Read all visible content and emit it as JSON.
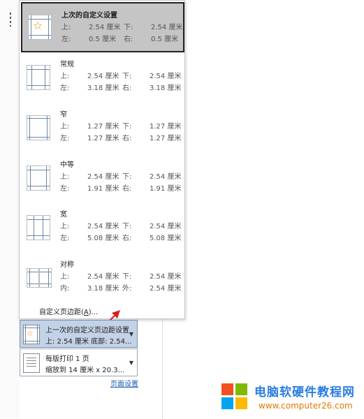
{
  "margins": {
    "options": [
      {
        "title": "上次的自定义设置",
        "k1": "上:",
        "v1": "2.54 厘米",
        "k2": "下:",
        "v2": "2.54 厘米",
        "k3": "左:",
        "v3": "0.5 厘米",
        "k4": "右:",
        "v4": "0.5 厘米"
      },
      {
        "title": "常规",
        "k1": "上:",
        "v1": "2.54 厘米",
        "k2": "下:",
        "v2": "2.54 厘米",
        "k3": "左:",
        "v3": "3.18 厘米",
        "k4": "右:",
        "v4": "3.18 厘米"
      },
      {
        "title": "窄",
        "k1": "上:",
        "v1": "1.27 厘米",
        "k2": "下:",
        "v2": "1.27 厘米",
        "k3": "左:",
        "v3": "1.27 厘米",
        "k4": "右:",
        "v4": "1.27 厘米"
      },
      {
        "title": "中等",
        "k1": "上:",
        "v1": "2.54 厘米",
        "k2": "下:",
        "v2": "2.54 厘米",
        "k3": "左:",
        "v3": "1.91 厘米",
        "k4": "右:",
        "v4": "1.91 厘米"
      },
      {
        "title": "宽",
        "k1": "上:",
        "v1": "2.54 厘米",
        "k2": "下:",
        "v2": "2.54 厘米",
        "k3": "左:",
        "v3": "5.08 厘米",
        "k4": "右:",
        "v4": "5.08 厘米"
      },
      {
        "title": "对称",
        "k1": "上:",
        "v1": "2.54 厘米",
        "k2": "下:",
        "v2": "2.54 厘米",
        "k3": "内:",
        "v3": "3.18 厘米",
        "k4": "外:",
        "v4": "2.54 厘米"
      }
    ],
    "custom_label": "自定义页边距(",
    "custom_key": "A",
    "custom_suffix": ")...",
    "selected_index": 0
  },
  "margin_button": {
    "line1": "上一次的自定义页边距设置",
    "line2": "上: 2.54 厘米 底部: 2.54..."
  },
  "pages_button": {
    "line1": "每版打印 1 页",
    "line2": "缩放到 14 厘米 x 20.3..."
  },
  "page_setup_link": "页面设置",
  "watermark": {
    "title": "电脑软硬件教程网",
    "url": "www.computer26.com",
    "colors": {
      "red": "#f25022",
      "green": "#7fba00",
      "blue": "#00a4ef",
      "yellow": "#ffb900"
    }
  },
  "icons": [
    "star-icon",
    "margin-page-icon",
    "chevron-down-icon",
    "windows-logo-icon",
    "red-arrow-icon"
  ]
}
